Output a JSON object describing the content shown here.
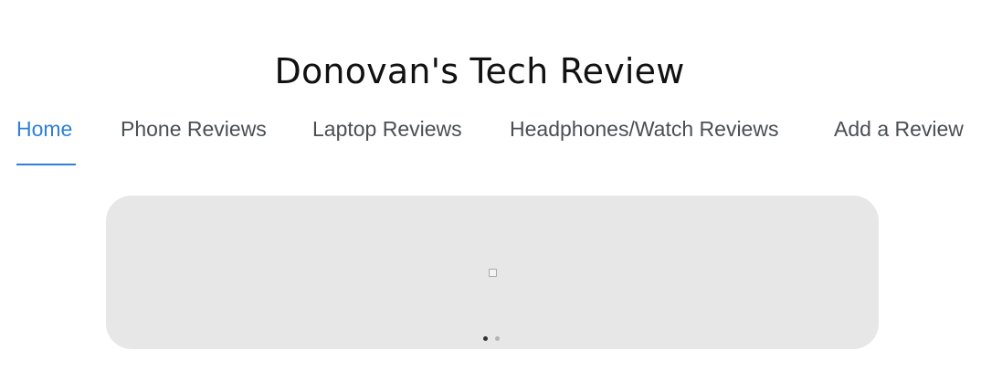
{
  "header": {
    "title": "Donovan's Tech Review"
  },
  "nav": {
    "active_color": "#2f80d8",
    "items": [
      {
        "label": "Home",
        "active": true
      },
      {
        "label": "Phone Reviews",
        "active": false
      },
      {
        "label": "Laptop Reviews",
        "active": false
      },
      {
        "label": "Headphones/Watch Reviews",
        "active": false
      },
      {
        "label": "Add a Review",
        "active": false
      }
    ]
  },
  "carousel": {
    "image_icon": "broken-image-icon",
    "slide_count": 2,
    "current_slide": 1
  }
}
